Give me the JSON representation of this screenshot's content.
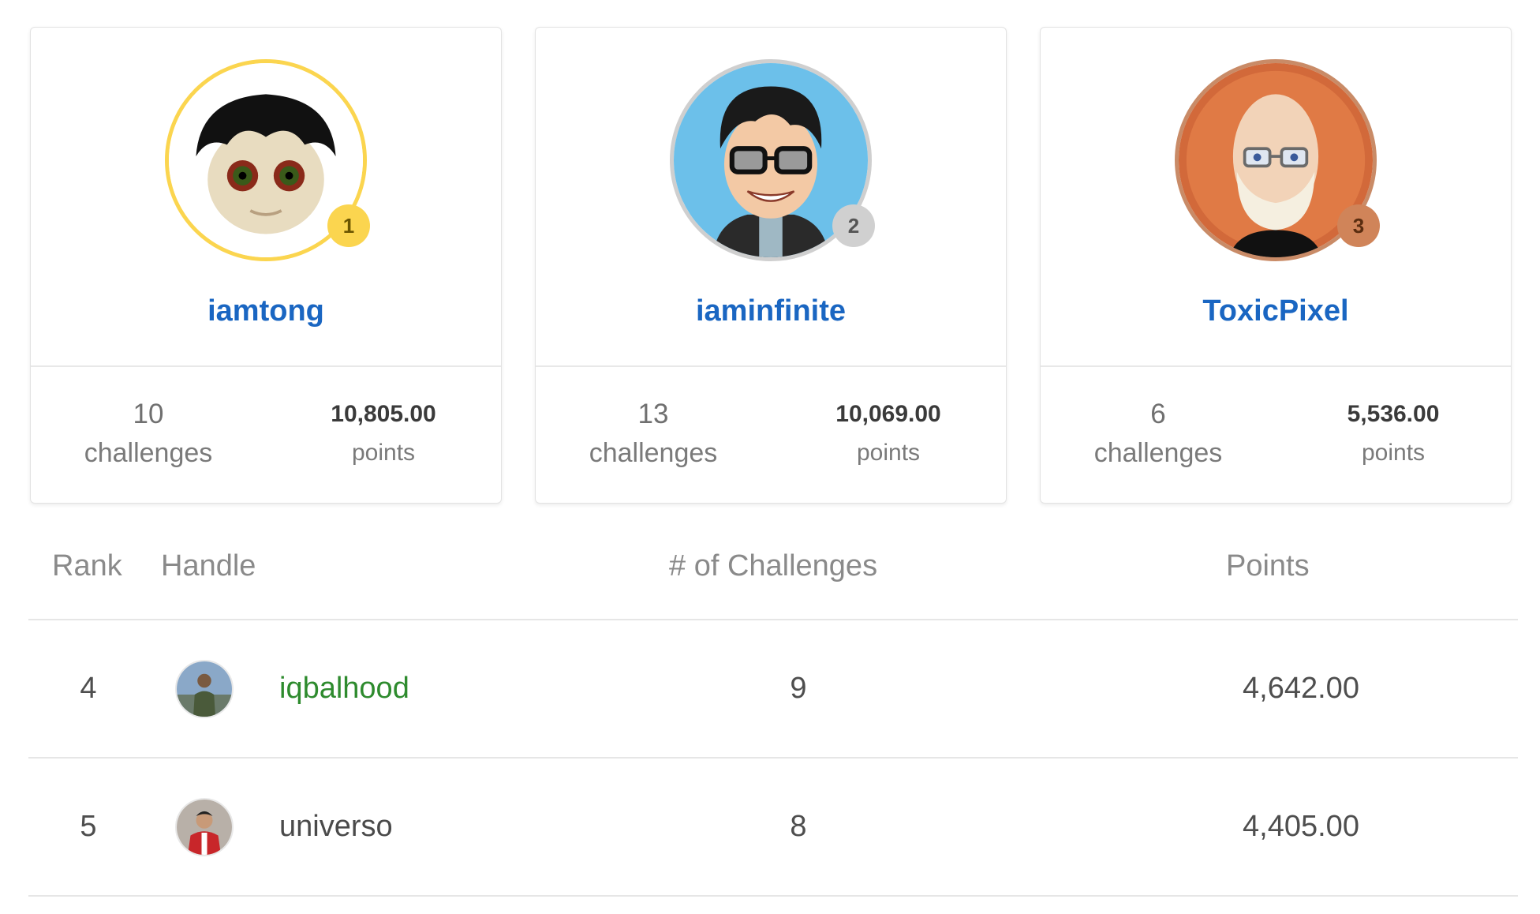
{
  "podium": [
    {
      "rank": "1",
      "handle": "iamtong",
      "challenges": "10",
      "challenges_label": "challenges",
      "points": "10,805.00",
      "points_label": "points",
      "ring_color": "#fbd54f"
    },
    {
      "rank": "2",
      "handle": "iaminfinite",
      "challenges": "13",
      "challenges_label": "challenges",
      "points": "10,069.00",
      "points_label": "points",
      "ring_color": "#cfcfcf"
    },
    {
      "rank": "3",
      "handle": "ToxicPixel",
      "challenges": "6",
      "challenges_label": "challenges",
      "points": "5,536.00",
      "points_label": "points",
      "ring_color": "#c98b67"
    }
  ],
  "table": {
    "headers": {
      "rank": "Rank",
      "handle": "Handle",
      "challenges": "# of Challenges",
      "points": "Points"
    },
    "rows": [
      {
        "rank": "4",
        "handle": "iqbalhood",
        "challenges": "9",
        "points": "4,642.00",
        "handle_color": "#2e8b2e"
      },
      {
        "rank": "5",
        "handle": "universo",
        "challenges": "8",
        "points": "4,405.00",
        "handle_color": "#4a4a4a"
      }
    ]
  },
  "colors": {
    "link_blue": "#1a66c2",
    "gold": "#fbd54f",
    "silver": "#d0d0d0",
    "bronze": "#d08459"
  }
}
